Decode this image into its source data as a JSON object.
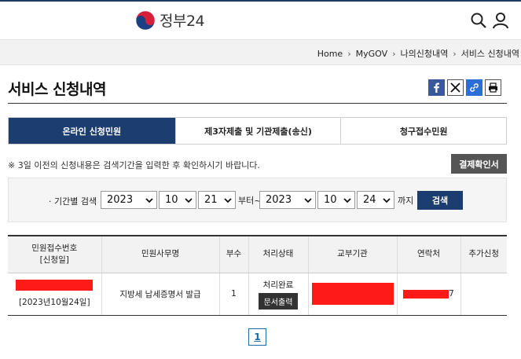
{
  "header": {
    "logo_text": "정부24",
    "icons": [
      "search-icon",
      "user-icon"
    ]
  },
  "breadcrumb": [
    "Home",
    "MyGOV",
    "나의신청내역",
    "서비스 신청내역"
  ],
  "page": {
    "title": "서비스 신청내역"
  },
  "share_icons": [
    "facebook-icon",
    "x-icon",
    "link-icon",
    "print-icon"
  ],
  "tabs": [
    {
      "label": "온라인 신청민원",
      "active": true
    },
    {
      "label": "제3자제출 및 기관제출(송신)",
      "active": false
    },
    {
      "label": "청구접수민원",
      "active": false
    }
  ],
  "notice": "※ 3일 이전의 신청내용은 검색기간을 입력한 후 확인하시기 바랍니다.",
  "confirm_button": "결제확인서",
  "search": {
    "label": "· 기간별 검색",
    "from": {
      "year": "2023",
      "month": "10",
      "day": "21"
    },
    "from_suffix": "부터~",
    "to": {
      "year": "2023",
      "month": "10",
      "day": "24"
    },
    "to_suffix": "까지",
    "button": "검색"
  },
  "table": {
    "headers": {
      "receipt_line1": "민원접수번호",
      "receipt_line2": "[신청일]",
      "service": "민원사무명",
      "copies": "부수",
      "status": "처리상태",
      "agency": "교부기관",
      "contact": "연락처",
      "extra": "추가신청"
    },
    "rows": [
      {
        "date": "[2023년10월24일]",
        "service": "지방세 납세증명서 발급",
        "copies": "1",
        "status": "처리완료",
        "doc_button": "문서출력",
        "contact_tail": "7",
        "extra": ""
      }
    ]
  },
  "pagination": {
    "current": "1"
  },
  "colors": {
    "brand_navy": "#1c3d6f",
    "redaction": "#ff1a1a",
    "link_blue": "#1c6aa8"
  }
}
